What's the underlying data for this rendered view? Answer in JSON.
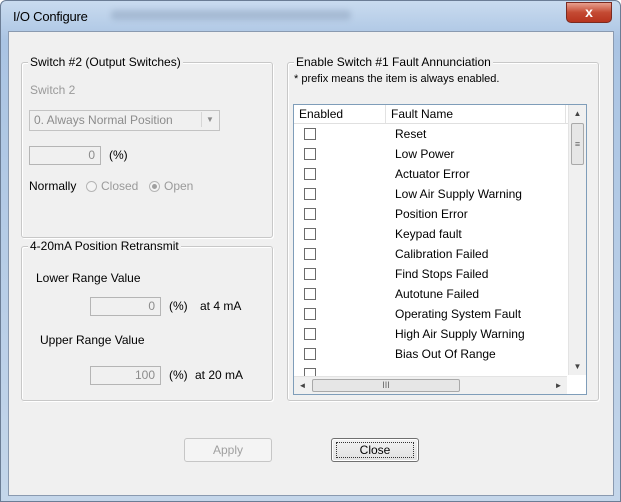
{
  "window": {
    "title": "I/O Configure",
    "close_glyph": "x"
  },
  "switch2": {
    "group_title": "Switch #2 (Output Switches)",
    "label": "Switch 2",
    "select_value": "0. Always Normal Position",
    "percent_value": "0",
    "percent_unit": "(%)",
    "normally_label": "Normally",
    "closed_label": "Closed",
    "open_label": "Open",
    "selected": "Open"
  },
  "retransmit": {
    "group_title": "4-20mA Position Retransmit",
    "lower_label": "Lower Range Value",
    "lower_value": "0",
    "lower_unit": "(%)",
    "lower_at": "at 4 mA",
    "upper_label": "Upper Range Value",
    "upper_value": "100",
    "upper_unit": "(%)",
    "upper_at": "at 20 mA"
  },
  "fault": {
    "group_title": "Enable Switch #1 Fault Annunciation",
    "note": "* prefix means the item is always enabled.",
    "columns": [
      "Enabled",
      "Fault Name"
    ],
    "rows": [
      {
        "name": "Reset",
        "checked": false
      },
      {
        "name": "Low Power",
        "checked": false
      },
      {
        "name": "Actuator Error",
        "checked": false
      },
      {
        "name": "Low Air Supply Warning",
        "checked": false
      },
      {
        "name": "Position Error",
        "checked": false
      },
      {
        "name": "Keypad fault",
        "checked": false
      },
      {
        "name": "Calibration Failed",
        "checked": false
      },
      {
        "name": "Find Stops Failed",
        "checked": false
      },
      {
        "name": "Autotune Failed",
        "checked": false
      },
      {
        "name": "Operating System Fault",
        "checked": false
      },
      {
        "name": "High Air Supply Warning",
        "checked": false
      },
      {
        "name": "Bias Out Of Range",
        "checked": false
      }
    ],
    "hscroll_thumb": "III"
  },
  "buttons": {
    "apply": "Apply",
    "close": "Close"
  },
  "icons": {
    "up": "▲",
    "down": "▼",
    "left": "◄",
    "right": "►",
    "combo": "▼"
  }
}
